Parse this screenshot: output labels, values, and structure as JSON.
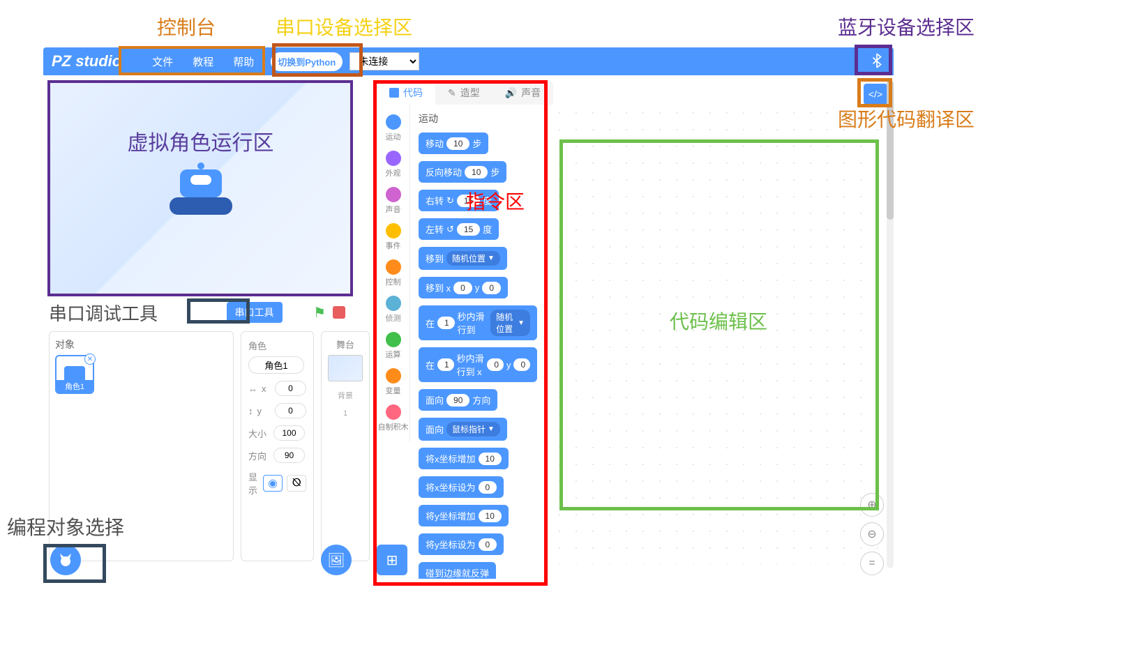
{
  "annotations": {
    "console": "控制台",
    "serial_select": "串口设备选择区",
    "bluetooth_select": "蓝牙设备选择区",
    "stage_area": "虚拟角色运行区",
    "serial_debug": "串口调试工具",
    "blocks_area": "指令区",
    "code_translate": "图形代码翻译区",
    "code_edit": "代码编辑区",
    "object_select": "编程对象选择"
  },
  "topbar": {
    "logo": "PZ studio",
    "menu": {
      "file": "文件",
      "tutorial": "教程",
      "help": "帮助"
    },
    "switch_python": "切换到Python",
    "connect_placeholder": "未连接"
  },
  "stage": {
    "serial_tool": "串口工具"
  },
  "sprite_panel": {
    "object_label": "对象",
    "thumb_label": "角色1"
  },
  "sprite_props": {
    "name_label": "角色",
    "name_value": "角色1",
    "x_label": "x",
    "x_value": "0",
    "y_label": "y",
    "y_value": "0",
    "size_label": "大小",
    "size_value": "100",
    "dir_label": "方向",
    "dir_value": "90",
    "show_label": "显示"
  },
  "stage_panel": {
    "label": "舞台",
    "bg_label": "背景",
    "bg_count": "1"
  },
  "tabs": {
    "code": "代码",
    "costume": "造型",
    "sound": "声音"
  },
  "categories": [
    {
      "label": "运动",
      "color": "#4c97ff"
    },
    {
      "label": "外观",
      "color": "#9966ff"
    },
    {
      "label": "声音",
      "color": "#cf63cf"
    },
    {
      "label": "事件",
      "color": "#ffbf00"
    },
    {
      "label": "控制",
      "color": "#ff8c1a"
    },
    {
      "label": "侦测",
      "color": "#5cb1d6"
    },
    {
      "label": "运算",
      "color": "#40bf4a"
    },
    {
      "label": "变量",
      "color": "#ff8c1a"
    },
    {
      "label": "自制积木",
      "color": "#ff6680"
    }
  ],
  "blocks_header": "运动",
  "blocks": {
    "move": {
      "pre": "移动",
      "val": "10",
      "post": "步"
    },
    "move_back": {
      "pre": "反向移动",
      "val": "10",
      "post": "步"
    },
    "turn_right": {
      "pre": "右转",
      "val": "15",
      "post": "度"
    },
    "turn_left": {
      "pre": "左转",
      "val": "15",
      "post": "度"
    },
    "goto_random": {
      "pre": "移到",
      "dd": "随机位置"
    },
    "goto_xy": {
      "pre": "移到 x",
      "x": "0",
      "mid": "y",
      "y": "0"
    },
    "glide_random": {
      "pre": "在",
      "sec": "1",
      "mid": "秒内滑行到",
      "dd": "随机位置"
    },
    "glide_xy": {
      "pre": "在",
      "sec": "1",
      "mid1": "秒内滑行到 x",
      "x": "0",
      "mid2": "y",
      "y": "0"
    },
    "point_dir": {
      "pre": "面向",
      "val": "90",
      "post": "方向"
    },
    "point_mouse": {
      "pre": "面向",
      "dd": "鼠标指针"
    },
    "change_x": {
      "pre": "将x坐标增加",
      "val": "10"
    },
    "set_x": {
      "pre": "将x坐标设为",
      "val": "0"
    },
    "change_y": {
      "pre": "将y坐标增加",
      "val": "10"
    },
    "set_y": {
      "pre": "将y坐标设为",
      "val": "0"
    },
    "bounce": {
      "text": "碰到边缘就反弹"
    }
  },
  "colors": {
    "orange": "#d97c1a",
    "yellow": "#f5d115",
    "purple": "#5c2e91",
    "red": "#ff0000",
    "green": "#6cc04a",
    "gray": "#606060",
    "teal": "#2a5a6a",
    "slategray": "#34495e"
  }
}
